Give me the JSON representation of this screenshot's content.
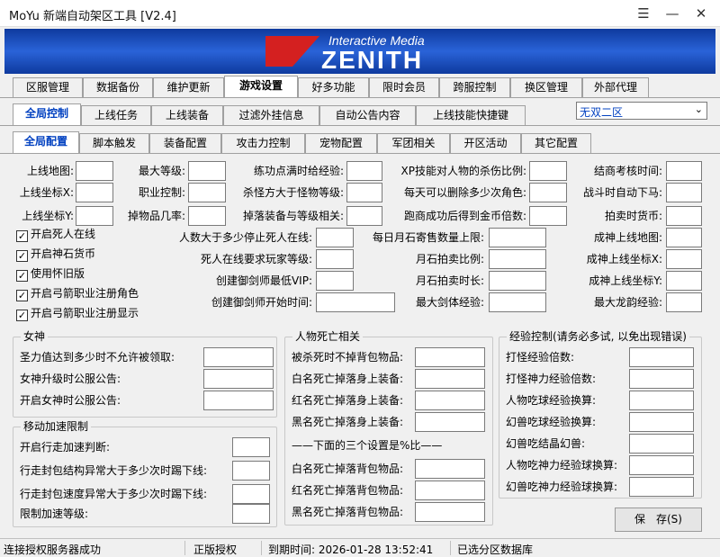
{
  "window": {
    "title": "MoYu 新端自动架区工具 [V2.4]",
    "menu_icon": "hamburger-icon",
    "min_icon": "minimize-icon",
    "close_icon": "close-icon"
  },
  "banner": {
    "subtitle": "Interactive Media",
    "logo_text": "ZENITH"
  },
  "main_tabs": [
    "区服管理",
    "数据备份",
    "维护更新",
    "游戏设置",
    "好多功能",
    "限时会员",
    "跨服控制",
    "换区管理",
    "外部代理"
  ],
  "main_active": "游戏设置",
  "sub_tabs": [
    "全局控制",
    "上线任务",
    "上线装备",
    "过滤外挂信息",
    "自动公告内容",
    "上线技能快捷键"
  ],
  "sub_active": "全局控制",
  "server_select": "无双二区",
  "config_tabs": [
    "全局配置",
    "脚本触发",
    "装备配置",
    "攻击力控制",
    "宠物配置",
    "军团相关",
    "开区活动",
    "其它配置"
  ],
  "config_active": "全局配置",
  "col1": [
    "上线地图:",
    "上线坐标X:",
    "上线坐标Y:"
  ],
  "col2": [
    "最大等级:",
    "职业控制:",
    "掉物品几率:"
  ],
  "col3": [
    "练功点满时给经验:",
    "杀怪方大于怪物等级:",
    "掉落装备与等级相关:"
  ],
  "col4": [
    "XP技能对人物的杀伤比例:",
    "每天可以删除多少次角色:",
    "跑商成功后得到金币倍数:"
  ],
  "col5": [
    "结商考核时间:",
    "战斗时自动下马:",
    "拍卖时货币:"
  ],
  "checkboxes": [
    "开启死人在线",
    "开启神石货币",
    "使用怀旧版",
    "开启弓箭职业注册角色",
    "开启弓箭职业注册显示"
  ],
  "mid_left": [
    "人数大于多少停止死人在线:",
    "死人在线要求玩家等级:",
    "创建御剑师最低VIP:",
    "创建御剑师开始时间:"
  ],
  "mid_center": [
    "每日月石寄售数量上限:",
    "月石拍卖比例:",
    "月石拍卖时长:",
    "最大剑体经验:"
  ],
  "mid_right": [
    "成神上线地图:",
    "成神上线坐标X:",
    "成神上线坐标Y:",
    "最大龙韵经验:"
  ],
  "goddess": {
    "title": "女神",
    "items": [
      "圣力值达到多少时不允许被领取:",
      "女神升级时公服公告:",
      "开启女神时公服公告:"
    ]
  },
  "speed": {
    "title": "移动加速限制",
    "items": [
      "开启行走加速判断:",
      "行走封包结构异常大于多少次时踢下线:",
      "行走封包速度异常大于多少次时踢下线:",
      "限制加速等级:"
    ]
  },
  "death": {
    "title": "人物死亡相关",
    "items": [
      "被杀死时不掉背包物品:",
      "白名死亡掉落身上装备:",
      "红名死亡掉落身上装备:",
      "黑名死亡掉落身上装备:"
    ],
    "divider": "——下面的三个设置是%比——",
    "items2": [
      "白名死亡掉落背包物品:",
      "红名死亡掉落背包物品:",
      "黑名死亡掉落背包物品:"
    ]
  },
  "exp": {
    "title": "经验控制(请务必多试, 以免出现错误)",
    "items": [
      "打怪经验倍数:",
      "打怪神力经验倍数:",
      "人物吃球经验换算:",
      "幻兽吃球经验换算:",
      "幻兽吃结晶幻兽:",
      "人物吃神力经验球换算:",
      "幻兽吃神力经验球换算:"
    ]
  },
  "save_label": "保　存(S)",
  "status": [
    "连接授权服务器成功",
    "正版授权",
    "到期时间: 2026-01-28 13:52:41",
    "已选分区数据库"
  ]
}
